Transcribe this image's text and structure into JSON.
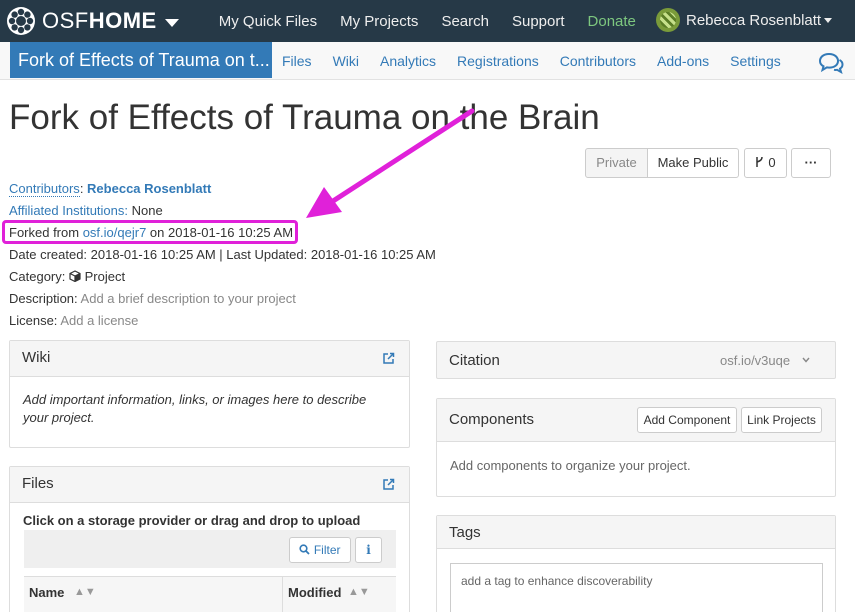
{
  "topnav": {
    "brand_light": "OSF",
    "brand_bold": "HOME",
    "links": [
      "My Quick Files",
      "My Projects",
      "Search",
      "Support",
      "Donate"
    ],
    "user_name": "Rebecca Rosenblatt"
  },
  "projnav": {
    "title": "Fork of Effects of Trauma on t...",
    "tabs": [
      "Files",
      "Wiki",
      "Analytics",
      "Registrations",
      "Contributors",
      "Add-ons",
      "Settings"
    ]
  },
  "page": {
    "title": "Fork of Effects of Trauma on the Brain"
  },
  "buttons": {
    "private": "Private",
    "make_public": "Make Public",
    "fork_count": "0",
    "more": "···"
  },
  "meta": {
    "contributors_label": "Contributors",
    "contributors_value": "Rebecca Rosenblatt",
    "institutions_label": "Affiliated Institutions:",
    "institutions_value": "None",
    "forked_prefix": "Forked from",
    "forked_link": "osf.io/qejr7",
    "forked_suffix": "on 2018-01-16 10:25 AM",
    "dates": "Date created: 2018-01-16 10:25 AM | Last Updated: 2018-01-16 10:25 AM",
    "category_label": "Category:",
    "category_value": "Project",
    "description_label": "Description:",
    "description_value": "Add a brief description to your project",
    "license_label": "License:",
    "license_value": "Add a license"
  },
  "wiki": {
    "title": "Wiki",
    "body": "Add important information, links, or images here to describe your project."
  },
  "files": {
    "title": "Files",
    "instruction": "Click on a storage provider or drag and drop to upload",
    "filter_label": "Filter",
    "col_name": "Name",
    "col_modified": "Modified"
  },
  "citation": {
    "title": "Citation",
    "value": "osf.io/v3uqe"
  },
  "components": {
    "title": "Components",
    "add_label": "Add Component",
    "link_label": "Link Projects",
    "body": "Add components to organize your project."
  },
  "tags": {
    "title": "Tags",
    "placeholder": "add a tag to enhance discoverability"
  },
  "colors": {
    "nav_bg": "#263947",
    "accent_blue": "#337ab7",
    "donate_green": "#7dc77f",
    "highlight_magenta": "#e021d9"
  }
}
